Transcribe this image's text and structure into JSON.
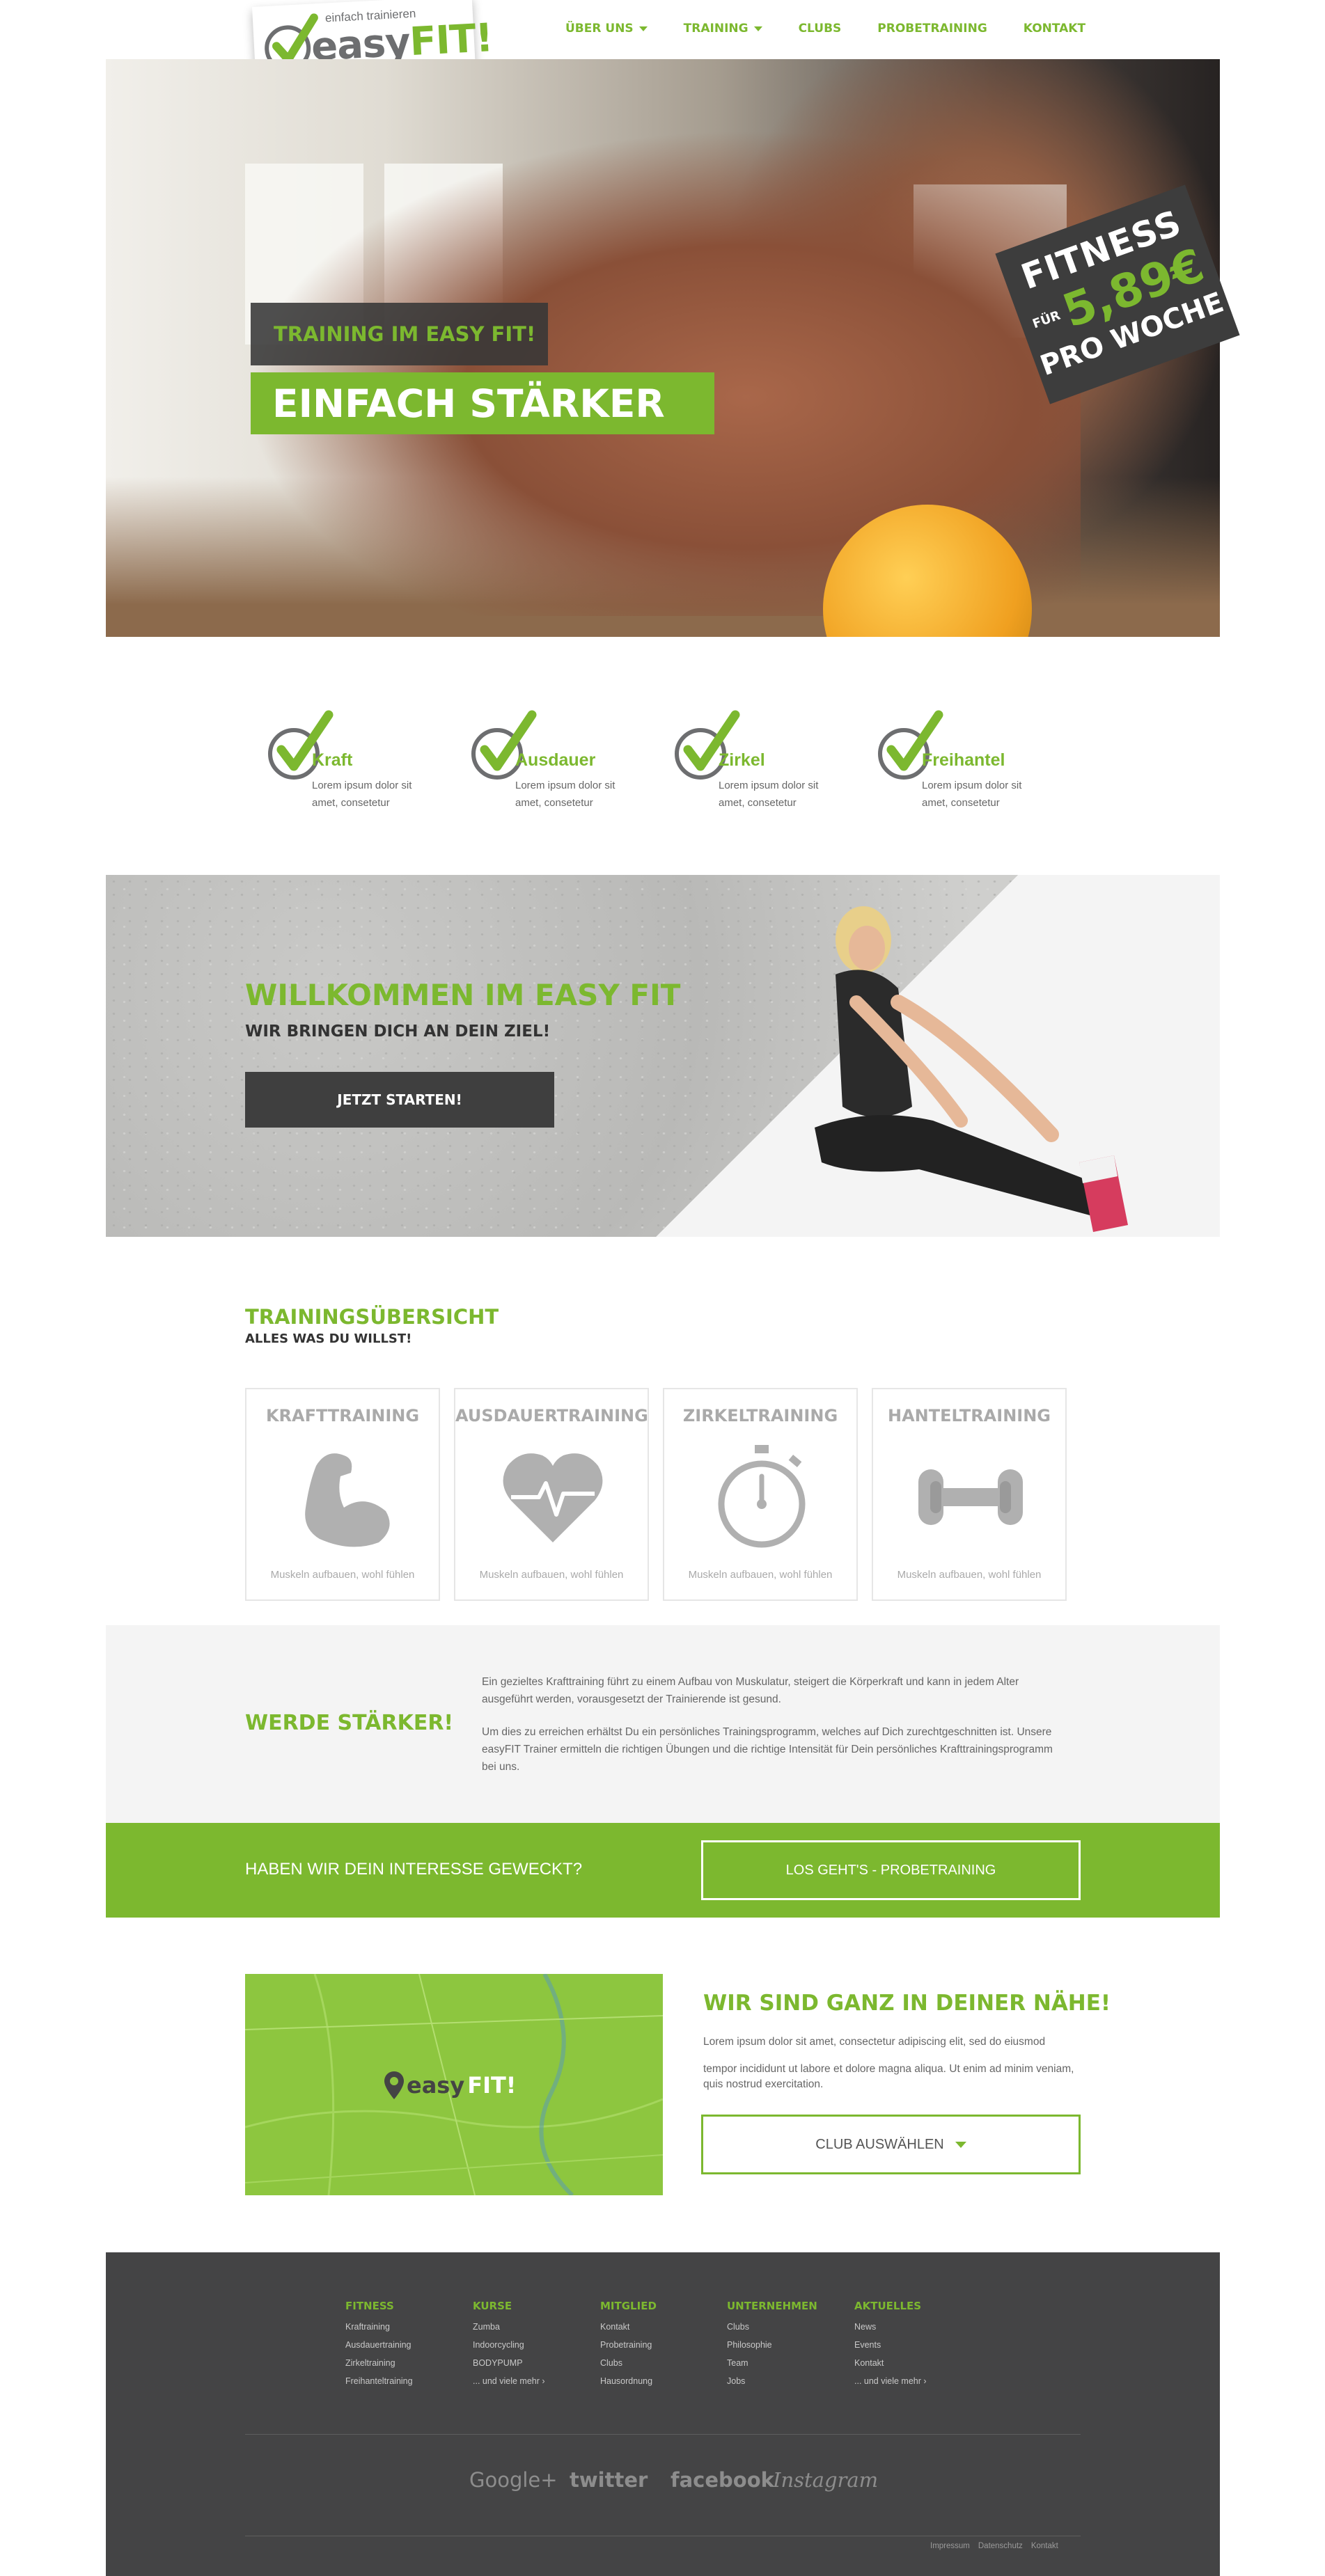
{
  "header": {
    "logo": {
      "tagline": "einfach trainieren",
      "brand_easy": "easy",
      "brand_fit": "FIT!"
    },
    "nav": [
      {
        "label": "ÜBER UNS",
        "has_dropdown": true
      },
      {
        "label": "TRAINING",
        "has_dropdown": true
      },
      {
        "label": "CLUBS",
        "has_dropdown": false
      },
      {
        "label": "PROBETRAINING",
        "has_dropdown": false
      },
      {
        "label": "KONTAKT",
        "has_dropdown": false
      }
    ]
  },
  "hero": {
    "label1": "TRAINING IM EASY FIT!",
    "label2": "EINFACH STÄRKER",
    "badge": {
      "line1": "FITNESS",
      "fuer": "FÜR",
      "price": "5,89€",
      "line3": "PRO WOCHE"
    }
  },
  "features": [
    {
      "title": "Kraft",
      "text": "Lorem ipsum dolor sit amet, consetetur"
    },
    {
      "title": "Ausdauer",
      "text": "Lorem ipsum dolor sit amet, consetetur"
    },
    {
      "title": "Zirkel",
      "text": "Lorem ipsum dolor sit amet, consetetur"
    },
    {
      "title": "Freihantel",
      "text": "Lorem ipsum dolor sit amet, consetetur"
    }
  ],
  "welcome": {
    "title": "WILLKOMMEN IM EASY FIT",
    "subtitle": "WIR BRINGEN DICH AN DEIN ZIEL!",
    "button": "JETZT STARTEN!"
  },
  "overview": {
    "title": "TRAININGSÜBERSICHT",
    "subtitle": "ALLES WAS DU WILLST!",
    "cards": [
      {
        "title": "KRAFTTRAINING",
        "icon": "bicep-icon",
        "text": "Muskeln aufbauen, wohl fühlen"
      },
      {
        "title": "AUSDAUERTRAINING",
        "icon": "heart-pulse-icon",
        "text": "Muskeln aufbauen, wohl fühlen"
      },
      {
        "title": "ZIRKELTRAINING",
        "icon": "stopwatch-icon",
        "text": "Muskeln aufbauen, wohl fühlen"
      },
      {
        "title": "HANTELTRAINING",
        "icon": "dumbbell-icon",
        "text": "Muskeln aufbauen, wohl fühlen"
      }
    ]
  },
  "stronger": {
    "title": "WERDE STÄRKER!",
    "p1": "Ein gezieltes Krafttraining führt zu einem Aufbau von Muskulatur, steigert die Körperkraft und kann in jedem Alter ausgeführt werden, vorausgesetzt der Trainierende ist gesund.",
    "p2": "Um dies zu erreichen erhältst Du ein persönliches Trainingsprogramm, welches auf Dich zurechtgeschnitten ist. Unsere easyFIT Trainer ermitteln die richtigen Übungen und die richtige Intensität für Dein persönliches Krafttrainingsprogramm bei uns."
  },
  "cta": {
    "text": "HABEN WIR DEIN INTERESSE GEWECKT?",
    "button": "LOS GEHT'S - PROBETRAINING"
  },
  "location": {
    "map_brand_easy": "easy",
    "map_brand_fit": "FIT!",
    "title": "WIR SIND GANZ IN DEINER NÄHE!",
    "p1": "Lorem ipsum dolor sit amet, consectetur adipiscing elit, sed do eiusmod",
    "p2": "tempor incididunt ut labore et dolore magna aliqua. Ut enim ad minim veniam, quis nostrud exercitation.",
    "select": "CLUB AUSWÄHLEN"
  },
  "footer": {
    "columns": [
      {
        "title": "FITNESS",
        "items": [
          "Kraftraining",
          "Ausdauertraining",
          "Zirkeltraining",
          "Freihanteltraining"
        ]
      },
      {
        "title": "KURSE",
        "items": [
          "Zumba",
          "Indoorcycling",
          "BODYPUMP",
          "... und viele mehr ›"
        ]
      },
      {
        "title": "MITGLIED",
        "items": [
          "Kontakt",
          "Probetraining",
          "Clubs",
          "Hausordnung"
        ]
      },
      {
        "title": "UNTERNEHMEN",
        "items": [
          "Clubs",
          "Philosophie",
          "Team",
          "Jobs"
        ]
      },
      {
        "title": "AKTUELLES",
        "items": [
          "News",
          "Events",
          "Kontakt",
          "... und viele mehr ›"
        ]
      }
    ],
    "social": [
      "Google+",
      "twitter",
      "facebook",
      "Instagram"
    ],
    "links": [
      "Impressum",
      "Datenschutz",
      "Kontakt"
    ]
  },
  "colors": {
    "accent": "#7cb82f",
    "dark": "#3f3f3f",
    "footer": "#444445",
    "light_bg": "#f4f4f4"
  }
}
